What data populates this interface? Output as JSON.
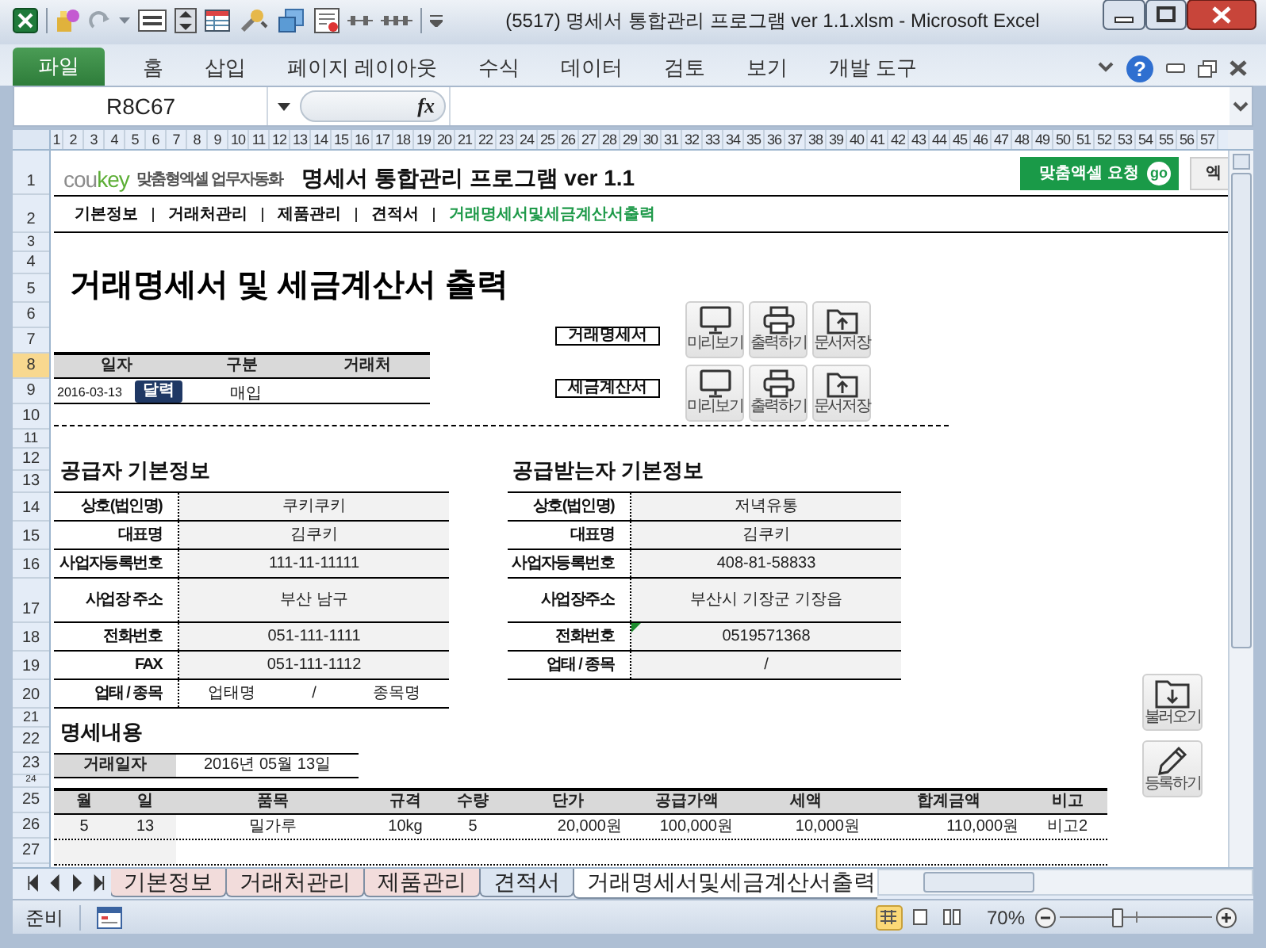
{
  "window": {
    "title": "(5517) 명세서 통합관리 프로그램 ver 1.1.xlsm  -  Microsoft Excel"
  },
  "ribbon_tabs": [
    {
      "label": "파일",
      "kind": "file",
      "selected": false
    },
    {
      "label": "홈",
      "kind": "tab",
      "selected": false
    },
    {
      "label": "삽입",
      "kind": "tab",
      "selected": false
    },
    {
      "label": "페이지 레이아웃",
      "kind": "tab",
      "selected": false
    },
    {
      "label": "수식",
      "kind": "tab",
      "selected": false
    },
    {
      "label": "데이터",
      "kind": "tab",
      "selected": false
    },
    {
      "label": "검토",
      "kind": "tab",
      "selected": false
    },
    {
      "label": "보기",
      "kind": "tab",
      "selected": false
    },
    {
      "label": "개발 도구",
      "kind": "tab",
      "selected": false
    }
  ],
  "help": "?",
  "formula_bar": {
    "name_box": "R8C67",
    "function_label": "fx"
  },
  "column_headers": [
    "1",
    "2",
    "3",
    "4",
    "5",
    "6",
    "7",
    "8",
    "9",
    "10",
    "11",
    "12",
    "13",
    "14",
    "15",
    "16",
    "17",
    "18",
    "19",
    "20",
    "21",
    "22",
    "23",
    "24",
    "25",
    "26",
    "27",
    "28",
    "29",
    "30",
    "31",
    "32",
    "33",
    "34",
    "35",
    "36",
    "37",
    "38",
    "39",
    "40",
    "41",
    "42",
    "43",
    "44",
    "45",
    "46",
    "47",
    "48",
    "49",
    "50",
    "51",
    "52",
    "53",
    "54",
    "55",
    "56",
    "57"
  ],
  "row_headers": [
    {
      "label": "1",
      "selected": false
    },
    {
      "label": "2",
      "selected": false
    },
    {
      "label": "3",
      "selected": false
    },
    {
      "label": "4",
      "selected": false
    },
    {
      "label": "5",
      "selected": false
    },
    {
      "label": "6",
      "selected": false
    },
    {
      "label": "7",
      "selected": false
    },
    {
      "label": "8",
      "selected": true
    },
    {
      "label": "9",
      "selected": false
    },
    {
      "label": "10",
      "selected": false
    },
    {
      "label": "11",
      "selected": false
    },
    {
      "label": "12",
      "selected": false
    },
    {
      "label": "13",
      "selected": false
    },
    {
      "label": "14",
      "selected": false
    },
    {
      "label": "15",
      "selected": false
    },
    {
      "label": "16",
      "selected": false
    },
    {
      "label": "17",
      "selected": false
    },
    {
      "label": "18",
      "selected": false
    },
    {
      "label": "19",
      "selected": false
    },
    {
      "label": "20",
      "selected": false
    },
    {
      "label": "21",
      "selected": false
    },
    {
      "label": "22",
      "selected": false
    },
    {
      "label": "23",
      "selected": false
    },
    {
      "label": "24",
      "selected": false
    },
    {
      "label": "25",
      "selected": false
    },
    {
      "label": "26",
      "selected": false
    },
    {
      "label": "27",
      "selected": false
    }
  ],
  "header": {
    "logo_start": "cou",
    "logo_end": "key",
    "tagline": "맞춤형엑셀 업무자동화",
    "program_title": "명세서 통합관리 프로그램 ver 1.1",
    "request_button": "맞춤액셀 요청",
    "go_badge": "go",
    "next_button": "엑"
  },
  "nav": [
    {
      "label": "기본정보",
      "selected": false
    },
    {
      "label": "거래처관리",
      "selected": false
    },
    {
      "label": "제품관리",
      "selected": false
    },
    {
      "label": "견적서",
      "selected": false
    },
    {
      "label": "거래명세서및세금계산서출력",
      "selected": true
    }
  ],
  "page_title": "거래명세서 및 세금계산서 출력",
  "transaction": {
    "columns": [
      "일자",
      "구분",
      "거래처"
    ],
    "date": "2016-03-13",
    "calendar_button": "달력",
    "type": "매입"
  },
  "output_groups": [
    {
      "label": "거래명세서",
      "buttons": [
        {
          "label": "미리보기",
          "kind": "preview"
        },
        {
          "label": "출력하기",
          "kind": "print"
        },
        {
          "label": "문서저장",
          "kind": "save"
        }
      ]
    },
    {
      "label": "세금계산서",
      "buttons": [
        {
          "label": "미리보기",
          "kind": "preview"
        },
        {
          "label": "출력하기",
          "kind": "print"
        },
        {
          "label": "문서저장",
          "kind": "save"
        }
      ]
    }
  ],
  "supplier": {
    "title": "공급자 기본정보",
    "rows": [
      {
        "label": "상호(법인명)",
        "values": [
          "쿠키쿠키"
        ]
      },
      {
        "label": "대표명",
        "values": [
          "김쿠키"
        ]
      },
      {
        "label": "사업자등록번호",
        "values": [
          "111-11-11111"
        ]
      },
      {
        "label": "사업장 주소",
        "values": [
          "부산 남구"
        ]
      },
      {
        "label": "전화번호",
        "values": [
          "051-111-1111"
        ]
      },
      {
        "label": "FAX",
        "values": [
          "051-111-1112"
        ]
      },
      {
        "label": "업태 / 종목",
        "values": [
          "업태명",
          "/",
          "종목명"
        ]
      }
    ]
  },
  "receiver": {
    "title": "공급받는자 기본정보",
    "rows": [
      {
        "label": "상호(법인명)",
        "values": [
          "저녁유통"
        ],
        "flag": false
      },
      {
        "label": "대표명",
        "values": [
          "김쿠키"
        ],
        "flag": false
      },
      {
        "label": "사업자등록번호",
        "values": [
          "408-81-58833"
        ],
        "flag": false
      },
      {
        "label": "사업장주소",
        "values": [
          "부산시 기장군 기장읍"
        ],
        "flag": false
      },
      {
        "label": "전화번호",
        "values": [
          "0519571368"
        ],
        "flag": true
      },
      {
        "label": "업태 / 종목",
        "values": [
          "/"
        ],
        "flag": false
      }
    ]
  },
  "side_buttons": [
    {
      "label": "불러오기",
      "kind": "load"
    },
    {
      "label": "등록하기",
      "kind": "register"
    }
  ],
  "details": {
    "title": "명세내용",
    "date_label": "거래일자",
    "date": "2016년 05월 13일",
    "columns": [
      "월",
      "일",
      "품목",
      "규격",
      "수량",
      "단가",
      "공급가액",
      "세액",
      "합계금액",
      "비고"
    ],
    "rows": [
      [
        "5",
        "13",
        "밀가루",
        "10kg",
        "5",
        "20,000원",
        "100,000원",
        "10,000원",
        "110,000원",
        "비고2"
      ]
    ]
  },
  "sheet_tabs": [
    {
      "label": "기본정보",
      "selected": false,
      "color": "#f2dcdb"
    },
    {
      "label": "거래처관리",
      "selected": false,
      "color": "#f2dcdb"
    },
    {
      "label": "제품관리",
      "selected": false,
      "color": "#f2dcdb"
    },
    {
      "label": "견적서",
      "selected": false,
      "color": "#dbe5f1"
    },
    {
      "label": "거래명세서및세금계산서출력",
      "selected": true,
      "color": "#ffffff"
    }
  ],
  "status_bar": {
    "status": "준비",
    "views": [
      {
        "kind": "normal",
        "selected": true
      },
      {
        "kind": "layout",
        "selected": false
      },
      {
        "kind": "pagebreak",
        "selected": false
      }
    ],
    "zoom": "70%",
    "level": 0.38
  }
}
